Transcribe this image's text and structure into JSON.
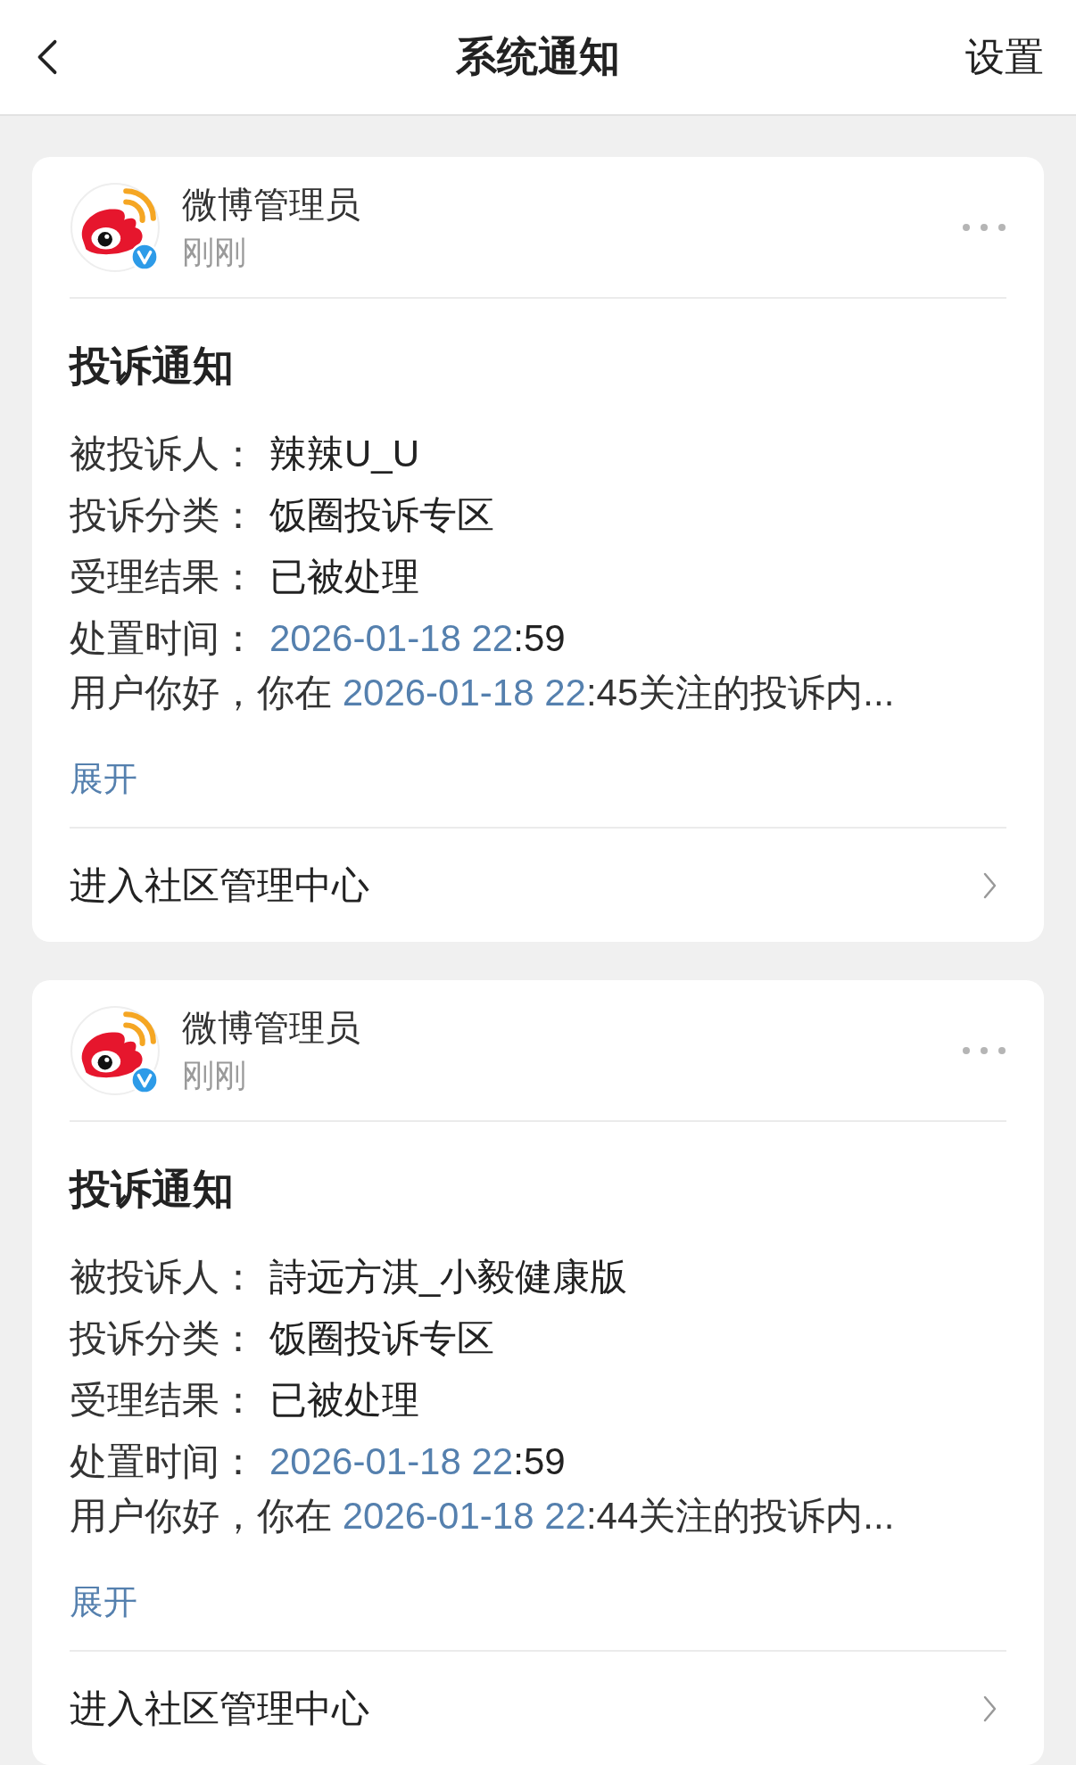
{
  "header": {
    "title": "系统通知",
    "action": "设置"
  },
  "notices": [
    {
      "sender": "微博管理员",
      "time": "刚刚",
      "verified": true,
      "title": "投诉通知",
      "fields": [
        {
          "label": "被投诉人：",
          "value": [
            {
              "text": "辣辣U_U",
              "link": false
            }
          ]
        },
        {
          "label": "投诉分类：",
          "value": [
            {
              "text": "饭圈投诉专区",
              "link": false
            }
          ]
        },
        {
          "label": "受理结果：",
          "value": [
            {
              "text": "已被处理",
              "link": false
            }
          ]
        },
        {
          "label": "处置时间：",
          "value": [
            {
              "text": "2026-01-18 22",
              "link": true
            },
            {
              "text": ":59",
              "link": false
            }
          ]
        }
      ],
      "message": [
        {
          "text": "用户你好，你在 ",
          "link": false
        },
        {
          "text": "2026-01-18 22",
          "link": true
        },
        {
          "text": ":45关注的投诉内...",
          "link": false
        }
      ],
      "expand": "展开",
      "footer_link": "进入社区管理中心"
    },
    {
      "sender": "微博管理员",
      "time": "刚刚",
      "verified": true,
      "title": "投诉通知",
      "fields": [
        {
          "label": "被投诉人：",
          "value": [
            {
              "text": "詩远方淇_小毅健康版",
              "link": false
            }
          ]
        },
        {
          "label": "投诉分类：",
          "value": [
            {
              "text": "饭圈投诉专区",
              "link": false
            }
          ]
        },
        {
          "label": "受理结果：",
          "value": [
            {
              "text": "已被处理",
              "link": false
            }
          ]
        },
        {
          "label": "处置时间：",
          "value": [
            {
              "text": "2026-01-18 22",
              "link": true
            },
            {
              "text": ":59",
              "link": false
            }
          ]
        }
      ],
      "message": [
        {
          "text": "用户你好，你在 ",
          "link": false
        },
        {
          "text": "2026-01-18 22",
          "link": true
        },
        {
          "text": ":44关注的投诉内...",
          "link": false
        }
      ],
      "expand": "展开",
      "footer_link": "进入社区管理中心"
    }
  ]
}
